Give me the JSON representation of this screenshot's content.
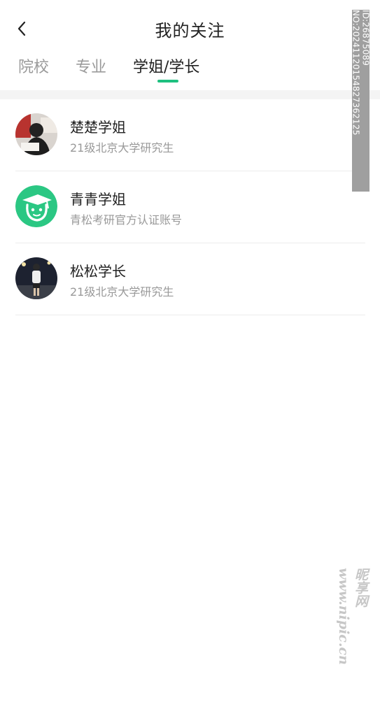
{
  "header": {
    "title": "我的关注"
  },
  "tabs": [
    {
      "label": "院校"
    },
    {
      "label": "专业"
    },
    {
      "label": "学姐/学长"
    }
  ],
  "accent_color": "#1ec080",
  "follows": [
    {
      "name": "楚楚学姐",
      "description": "21级北京大学研究生",
      "avatar": "photo-avatar"
    },
    {
      "name": "青青学姐",
      "description": "青松考研官方认证账号",
      "avatar": "mascot-logo-avatar"
    },
    {
      "name": "松松学长",
      "description": "21级北京大学研究生",
      "avatar": "photo-avatar"
    }
  ],
  "watermark": {
    "id_text": "ID:26875089 NO:20241120154827362125",
    "site_text": "昵享网 www.nipic.cn"
  }
}
